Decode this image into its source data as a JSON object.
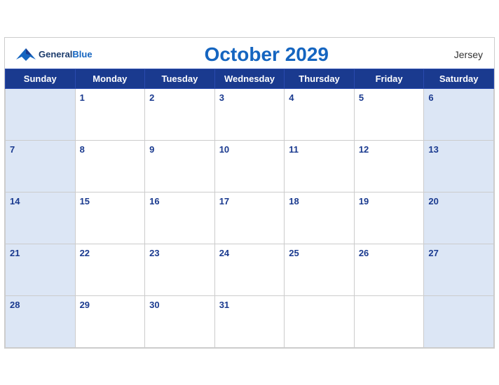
{
  "header": {
    "logo_general": "General",
    "logo_blue": "Blue",
    "title": "October 2029",
    "region": "Jersey"
  },
  "weekdays": [
    "Sunday",
    "Monday",
    "Tuesday",
    "Wednesday",
    "Thursday",
    "Friday",
    "Saturday"
  ],
  "weeks": [
    [
      null,
      1,
      2,
      3,
      4,
      5,
      6
    ],
    [
      7,
      8,
      9,
      10,
      11,
      12,
      13
    ],
    [
      14,
      15,
      16,
      17,
      18,
      19,
      20
    ],
    [
      21,
      22,
      23,
      24,
      25,
      26,
      27
    ],
    [
      28,
      29,
      30,
      31,
      null,
      null,
      null
    ]
  ]
}
